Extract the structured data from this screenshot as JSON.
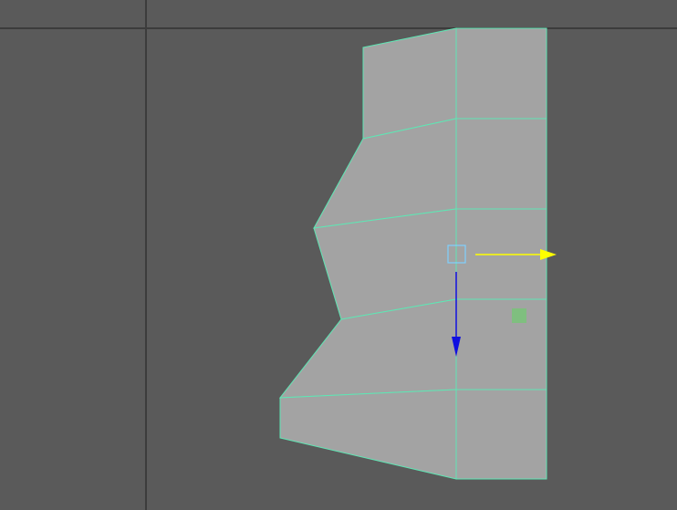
{
  "viewport": {
    "background_color": "#5a5a5a",
    "grid_axis_color": "#3c3c3c",
    "mesh_fill_color": "#a3a3a3",
    "wireframe_color": "#5fe6b4",
    "manipulator": {
      "x_axis_color": "#ffff00",
      "z_axis_color": "#1010e0",
      "center_handle_color": "#7fd0ff",
      "plane_handle_color": "#7fbf7f"
    }
  }
}
